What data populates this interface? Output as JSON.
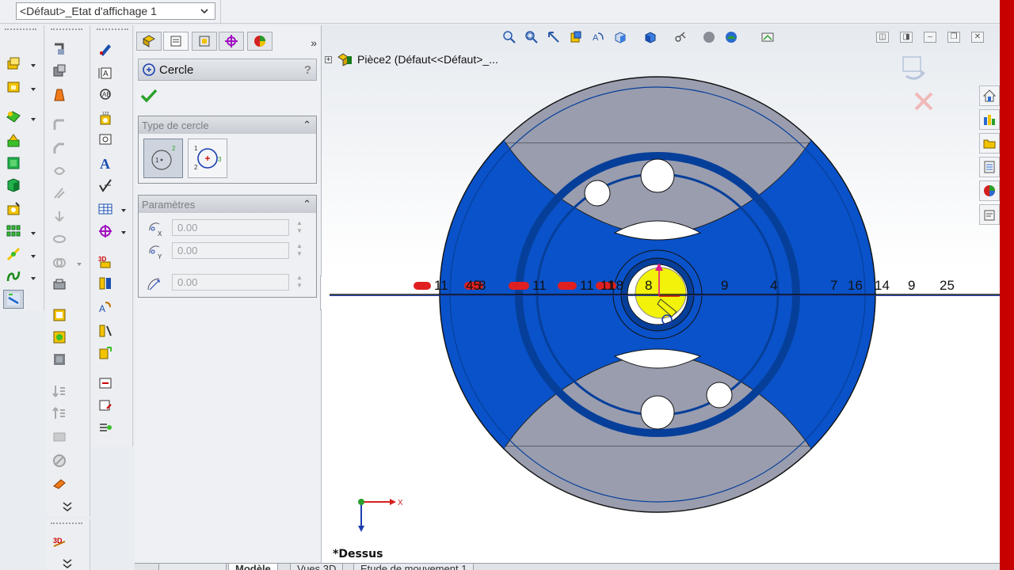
{
  "config": {
    "display_state": "<Défaut>_Etat d'affichage 1"
  },
  "property_manager": {
    "title": "Cercle",
    "help": "?",
    "collapse": "»",
    "circle_type_group": {
      "title": "Type de cercle",
      "options": [
        {
          "name": "centre-circle",
          "selected": true,
          "label_center": "1",
          "label_edge": "2"
        },
        {
          "name": "perimeter-circle",
          "selected": false,
          "label_points": [
            "1",
            "2",
            "3"
          ]
        }
      ]
    },
    "parameters_group": {
      "title": "Paramètres",
      "center_x": "0.00",
      "center_y": "0.00",
      "radius": "0.00"
    }
  },
  "graphics": {
    "tree_node": "Pièce2  (Défaut<<Défaut>_...",
    "view_name": "*Dessus",
    "triad": {
      "x_label": "X"
    },
    "sketch_line_numbers": [
      "11",
      "45",
      "8",
      "11",
      "11",
      "11",
      "18",
      "8",
      "9",
      "4",
      "7",
      "16",
      "14",
      "9",
      "25"
    ]
  },
  "bottom_tabs": [
    "Modèle",
    "Vues 3D",
    "Etude de mouvement 1"
  ],
  "colors": {
    "part_blue": "#0a52c9",
    "part_blue_dark": "#063f9a",
    "part_grey": "#9a9dae",
    "sketch_yellow": "#f2f20a",
    "accent_red": "#c70000"
  },
  "icons": {
    "toolbar_col1": [
      "extruded-boss-icon",
      "revolved-boss-icon",
      "swept-boss-icon",
      "lofted-boss-icon",
      "boundary-boss-icon",
      "extruded-cut-icon",
      "hole-wizard-icon",
      "linear-pattern-icon",
      "reference-geometry-icon",
      "curves-icon",
      "instant3d-icon"
    ],
    "toolbar_col2": [
      "smart-dimension-icon",
      "line-icon",
      "spline-icon",
      "fillet-icon",
      "chamfer-icon",
      "rib-icon",
      "draft-icon",
      "shell-icon",
      "wrap-icon",
      "intersect-icon",
      "mirror-icon",
      "rectangle-icon",
      "sketch-icon",
      "move-face-icon",
      "scale-icon",
      "split-line-icon",
      "delete-face-icon",
      "dome-icon",
      "expand-down-icon"
    ],
    "toolbar_col3": [
      "sketch-pen-icon",
      "dimension-text-icon",
      "note-icon",
      "balloon-icon",
      "datum-icon",
      "text-icon",
      "check-icon",
      "table-icon",
      "target-icon",
      "3d-sketch-icon",
      "layout-icon",
      "equation-icon",
      "mate-icon",
      "move-entity-icon",
      "convert-entity-icon",
      "offset-entity-icon",
      "trim-icon"
    ]
  }
}
